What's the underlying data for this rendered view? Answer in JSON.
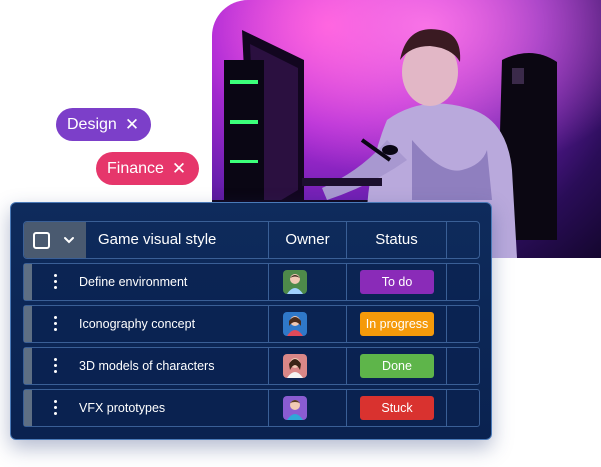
{
  "tags": [
    {
      "label": "Design",
      "color": "#7c3fc9"
    },
    {
      "label": "Finance",
      "color": "#e6366b"
    }
  ],
  "board": {
    "title": "Game visual style",
    "columns": {
      "owner": "Owner",
      "status": "Status"
    },
    "rows": [
      {
        "task": "Define environment",
        "status": "To do",
        "status_color": "#8a2bb8",
        "avatar_bg": "#4e8a4a"
      },
      {
        "task": "Iconography concept",
        "status": "In progress",
        "status_color": "#f59a0a",
        "avatar_bg": "#2f78c9"
      },
      {
        "task": "3D models of characters",
        "status": "Done",
        "status_color": "#5eb54a",
        "avatar_bg": "#d98787"
      },
      {
        "task": "VFX prototypes",
        "status": "Stuck",
        "status_color": "#d9322f",
        "avatar_bg": "#8a5cd1"
      }
    ]
  },
  "icons": {
    "tag_remove": "close-icon",
    "header_checkbox": "checkbox-icon",
    "header_chevron": "chevron-down-icon",
    "row_menu": "more-vertical-icon",
    "owner": "avatar-icon"
  }
}
